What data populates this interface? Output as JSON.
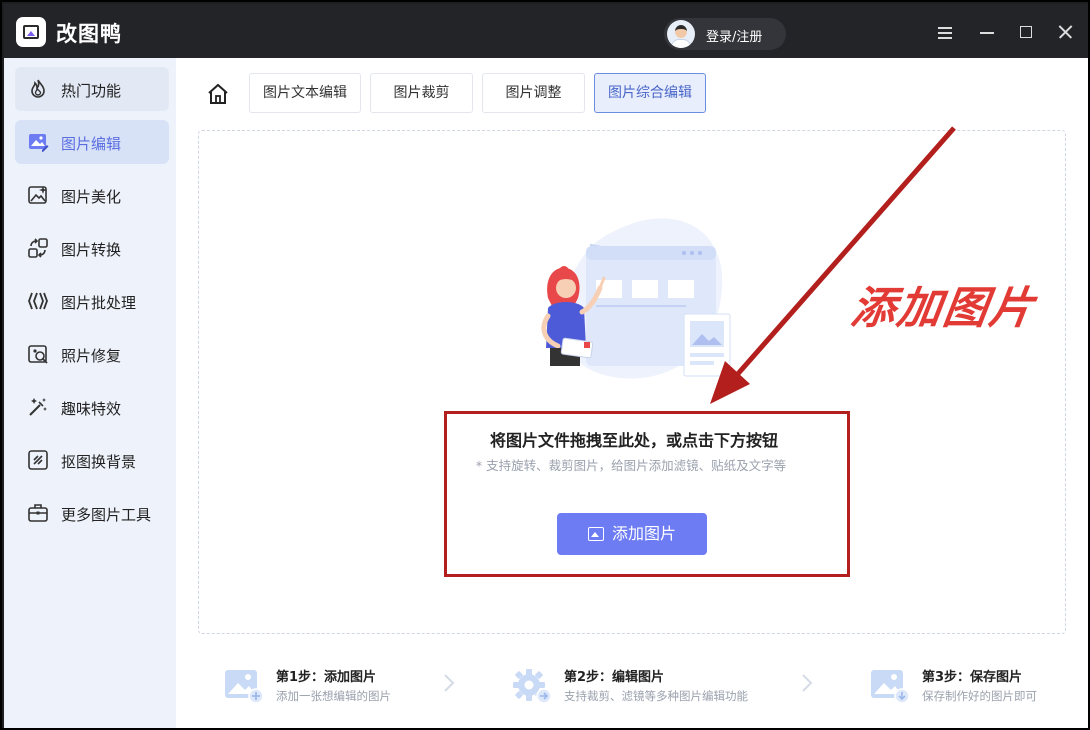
{
  "app": {
    "title": "改图鸭",
    "login_label": "登录/注册"
  },
  "sidebar": {
    "items": [
      {
        "label": "热门功能",
        "icon": "fire-icon"
      },
      {
        "label": "图片编辑",
        "icon": "image-edit-icon"
      },
      {
        "label": "图片美化",
        "icon": "image-beautify-icon"
      },
      {
        "label": "图片转换",
        "icon": "convert-icon"
      },
      {
        "label": "图片批处理",
        "icon": "batch-icon"
      },
      {
        "label": "照片修复",
        "icon": "photo-repair-icon"
      },
      {
        "label": "趣味特效",
        "icon": "magic-wand-icon"
      },
      {
        "label": "抠图换背景",
        "icon": "cutout-icon"
      },
      {
        "label": "更多图片工具",
        "icon": "toolbox-icon"
      }
    ],
    "active_index": 1
  },
  "tabs": [
    {
      "label": "图片文本编辑"
    },
    {
      "label": "图片裁剪"
    },
    {
      "label": "图片调整"
    },
    {
      "label": "图片综合编辑"
    }
  ],
  "dropzone": {
    "title": "将图片文件拖拽至此处，或点击下方按钮",
    "subtitle": "* 支持旋转、裁剪图片，给图片添加滤镜、贴纸及文字等",
    "button_label": "添加图片"
  },
  "annotation": {
    "text": "添加图片",
    "color": "#e23a34"
  },
  "steps": [
    {
      "title": "第1步：添加图片",
      "desc": "添加一张想编辑的图片"
    },
    {
      "title": "第2步：编辑图片",
      "desc": "支持裁剪、滤镜等多种图片编辑功能"
    },
    {
      "title": "第3步：保存图片",
      "desc": "保存制作好的图片即可"
    }
  ],
  "colors": {
    "accent": "#6d7cf2",
    "active_text": "#5b6ee1",
    "highlight_box": "#b21f1c"
  }
}
